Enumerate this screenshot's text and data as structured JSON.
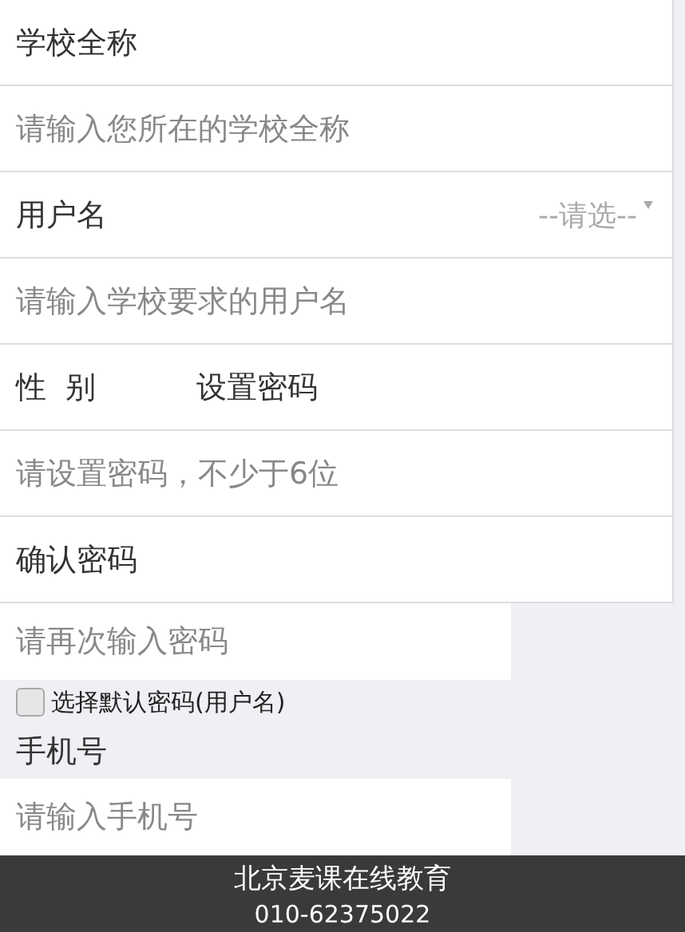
{
  "form": {
    "upper": [
      {
        "kind": "label",
        "text": "学校全称"
      },
      {
        "kind": "input",
        "placeholder": "请输入您所在的学校全称"
      },
      {
        "kind": "label-select",
        "text": "用户名",
        "select": "--请选--"
      },
      {
        "kind": "input",
        "placeholder": "请输入学校要求的用户名"
      },
      {
        "kind": "label-pair",
        "text": "性  别",
        "second": "设置密码"
      },
      {
        "kind": "input",
        "placeholder": "请设置密码，不少于6位"
      },
      {
        "kind": "label",
        "text": "确认密码"
      }
    ],
    "lower": [
      {
        "kind": "input",
        "placeholder": "请再次输入密码"
      },
      {
        "kind": "checkbox",
        "text": "选择默认密码(用户名)",
        "checked": false
      },
      {
        "kind": "label",
        "text": "手机号"
      },
      {
        "kind": "input",
        "placeholder": "请输入手机号"
      }
    ]
  },
  "footer": {
    "company": "北京麦课在线教育",
    "phone": "010-62375022"
  }
}
